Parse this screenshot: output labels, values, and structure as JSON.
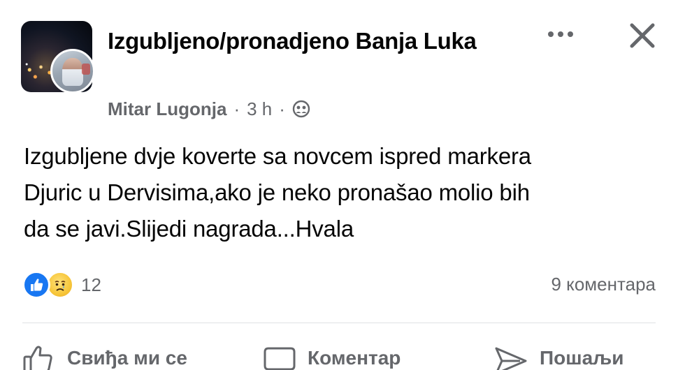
{
  "post": {
    "group_name": "Izgubljeno/pronadjeno Banja Luka",
    "author": "Mitar Lugonja",
    "separator": "·",
    "time": "3 h",
    "privacy_icon": "group-privacy-icon",
    "body_line1": "Izgubljene dvje koverte sa novcem ispred markera",
    "body_line2": "Djuric u Dervisima,ako je neko pronašao molio bih",
    "body_line3": "da se javi.Slijedi nagrada...Hvala",
    "reaction_count": "12",
    "comment_count": "9 коментара"
  },
  "actions": {
    "like_label": "Свиђа ми се",
    "comment_label": "Коментар",
    "share_label": "Пошаљи"
  },
  "colors": {
    "accent": "#1877f2",
    "text": "#050505",
    "secondary_text": "#65676b",
    "divider": "#dfe1e4"
  }
}
